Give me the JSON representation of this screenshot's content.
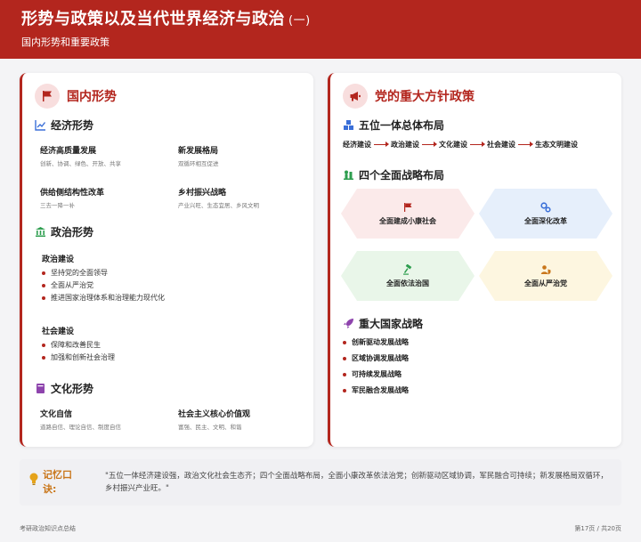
{
  "header": {
    "title": "形势与政策以及当代世界经济与政治",
    "title_suffix": "(一)",
    "subtitle": "国内形势和重要政策"
  },
  "left": {
    "title": "国内形势",
    "icon": "flag-icon",
    "economy": {
      "title": "经济形势",
      "icon": "chart-line-icon",
      "items": [
        {
          "title": "经济高质量发展",
          "desc": "创新、协调、绿色、开放、共享"
        },
        {
          "title": "新发展格局",
          "desc": "双循环相互促进"
        },
        {
          "title": "供给侧结构性改革",
          "desc": "三去一降一补"
        },
        {
          "title": "乡村振兴战略",
          "desc": "产业兴旺、生态宜居、乡风文明"
        }
      ]
    },
    "politics": {
      "title": "政治形势",
      "icon": "landmark-icon",
      "build_title": "政治建设",
      "build_items": [
        "坚持党的全面领导",
        "全面从严治党",
        "推进国家治理体系和治理能力现代化"
      ],
      "society_title": "社会建设",
      "society_items": [
        "保障和改善民生",
        "加强和创新社会治理"
      ]
    },
    "culture": {
      "title": "文化形势",
      "icon": "book-icon",
      "items": [
        {
          "title": "文化自信",
          "desc": "道路自信、理论自信、制度自信"
        },
        {
          "title": "社会主义核心价值观",
          "desc": "富强、民主、文明、和谐"
        }
      ]
    }
  },
  "right": {
    "title": "党的重大方针政策",
    "icon": "megaphone-icon",
    "layout": {
      "title": "五位一体总体布局",
      "icon": "cubes-icon",
      "nodes": [
        "经济建设",
        "政治建设",
        "文化建设",
        "社会建设",
        "生态文明建设"
      ]
    },
    "strategy": {
      "title": "四个全面战略布局",
      "icon": "chess-icon",
      "items": [
        {
          "label": "全面建成小康社会",
          "icon": "flag-icon",
          "color": "#fbeaea"
        },
        {
          "label": "全面深化改革",
          "icon": "gears-icon",
          "color": "#e6effb"
        },
        {
          "label": "全面依法治国",
          "icon": "gavel-icon",
          "color": "#e9f6e9"
        },
        {
          "label": "全面从严治党",
          "icon": "user-shield-icon",
          "color": "#fdf6e0"
        }
      ]
    },
    "national": {
      "title": "重大国家战略",
      "icon": "rocket-icon",
      "items": [
        "创新驱动发展战略",
        "区域协调发展战略",
        "可持续发展战略",
        "军民融合发展战略"
      ]
    }
  },
  "memo": {
    "label": "记忆口诀:",
    "icon": "lightbulb-icon",
    "text": "\"五位一体经济建设强，政治文化社会生态齐；四个全面战略布局，全面小康改革依法治党；创新驱动区域协调，军民融合可持续；新发展格局双循环，乡村振兴产业旺。\""
  },
  "footer": {
    "left": "考研政治知识点总结",
    "right": "第17页 / 共20页"
  }
}
